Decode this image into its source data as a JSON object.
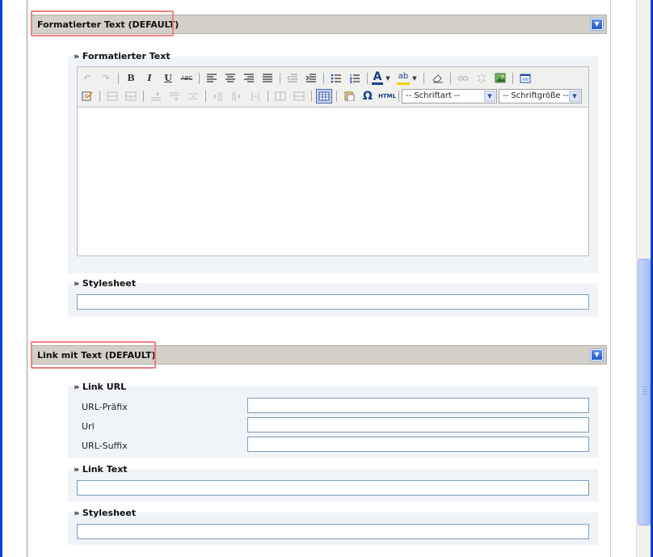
{
  "section1": {
    "title": "Formatierter Text (DEFAULT)",
    "field_label": "» Formatierter Text",
    "toolbar": {
      "bold": "B",
      "italic": "I",
      "underline": "U",
      "strikethrough": "ABC",
      "font_color": "A",
      "highlight": "ab",
      "html": "HTML",
      "special_char": "Ω",
      "font_select": "-- Schriftart --",
      "size_select": "-- Schriftgröße --"
    },
    "stylesheet_label": "» Stylesheet"
  },
  "section2": {
    "title": "Link mit Text (DEFAULT)",
    "link_url_label": "» Link URL",
    "rows": [
      "URL-Präfix",
      "Url",
      "URL-Suffix"
    ],
    "link_text_label": "» Link Text",
    "stylesheet_label": "» Stylesheet"
  },
  "colors": {
    "accent": "#2158c9",
    "highlight_border": "#ef7f7f",
    "header_bg": "#d4d0c8"
  }
}
